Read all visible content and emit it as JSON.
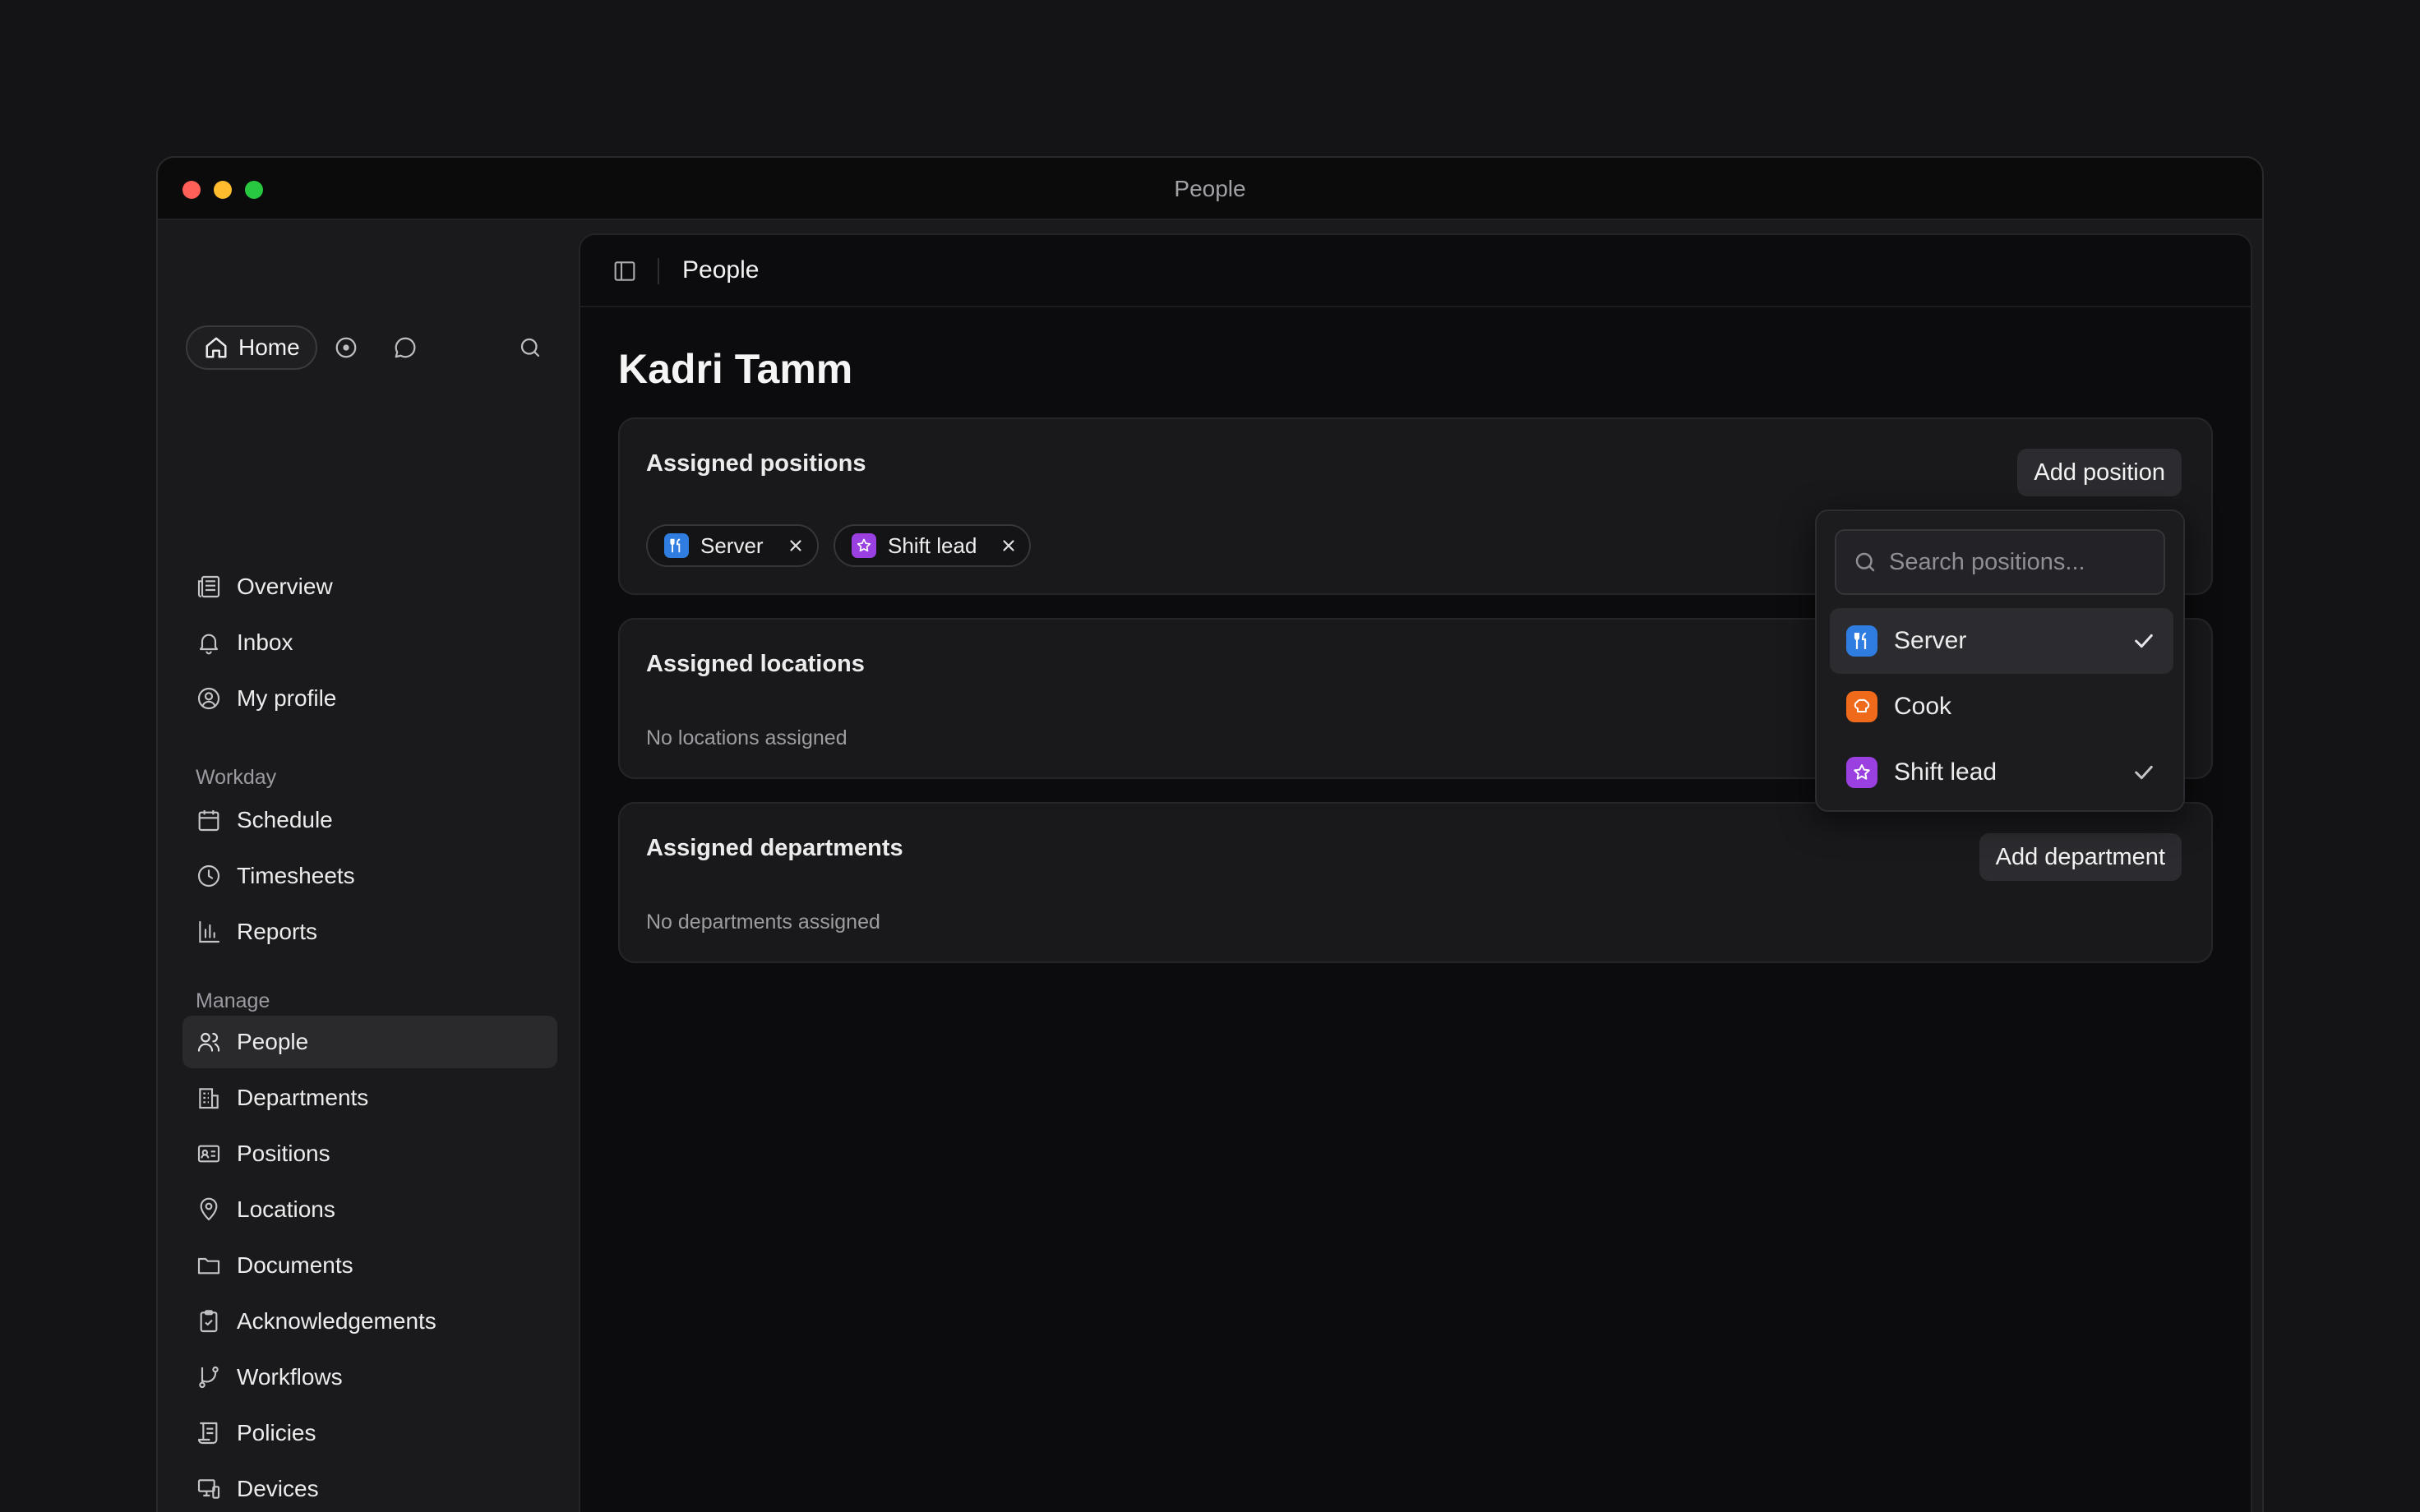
{
  "window": {
    "title": "People"
  },
  "sidebar": {
    "home_label": "Home",
    "top_items": [
      {
        "label": "Overview",
        "icon": "newspaper-icon"
      },
      {
        "label": "Inbox",
        "icon": "bell-icon"
      },
      {
        "label": "My profile",
        "icon": "user-circle-icon"
      }
    ],
    "workday_label": "Workday",
    "workday_items": [
      {
        "label": "Schedule",
        "icon": "calendar-icon"
      },
      {
        "label": "Timesheets",
        "icon": "clock-icon"
      },
      {
        "label": "Reports",
        "icon": "bar-chart-icon"
      }
    ],
    "manage_label": "Manage",
    "manage_items": [
      {
        "label": "People",
        "icon": "users-icon",
        "active": true
      },
      {
        "label": "Departments",
        "icon": "building-icon"
      },
      {
        "label": "Positions",
        "icon": "id-card-icon"
      },
      {
        "label": "Locations",
        "icon": "map-pin-icon"
      },
      {
        "label": "Documents",
        "icon": "folder-icon"
      },
      {
        "label": "Acknowledgements",
        "icon": "clipboard-check-icon"
      },
      {
        "label": "Workflows",
        "icon": "git-branch-icon"
      },
      {
        "label": "Policies",
        "icon": "scroll-icon"
      },
      {
        "label": "Devices",
        "icon": "devices-icon"
      }
    ]
  },
  "header": {
    "title": "People"
  },
  "person": {
    "name": "Kadri Tamm"
  },
  "positions_card": {
    "title": "Assigned positions",
    "add_label": "Add position",
    "chips": [
      {
        "label": "Server",
        "icon": "utensils-icon",
        "color": "#2f7de1"
      },
      {
        "label": "Shift lead",
        "icon": "star-icon",
        "color": "#9a3fe0"
      }
    ]
  },
  "locations_card": {
    "title": "Assigned locations",
    "empty_text": "No locations assigned"
  },
  "departments_card": {
    "title": "Assigned departments",
    "add_label": "Add department",
    "empty_text": "No departments assigned"
  },
  "dropdown": {
    "search_placeholder": "Search positions...",
    "options": [
      {
        "label": "Server",
        "icon": "utensils-icon",
        "color": "#2f7de1",
        "selected": true
      },
      {
        "label": "Cook",
        "icon": "chef-hat-icon",
        "color": "#ef6a1a",
        "selected": false
      },
      {
        "label": "Shift lead",
        "icon": "star-icon",
        "color": "#9a3fe0",
        "selected": true
      }
    ]
  }
}
